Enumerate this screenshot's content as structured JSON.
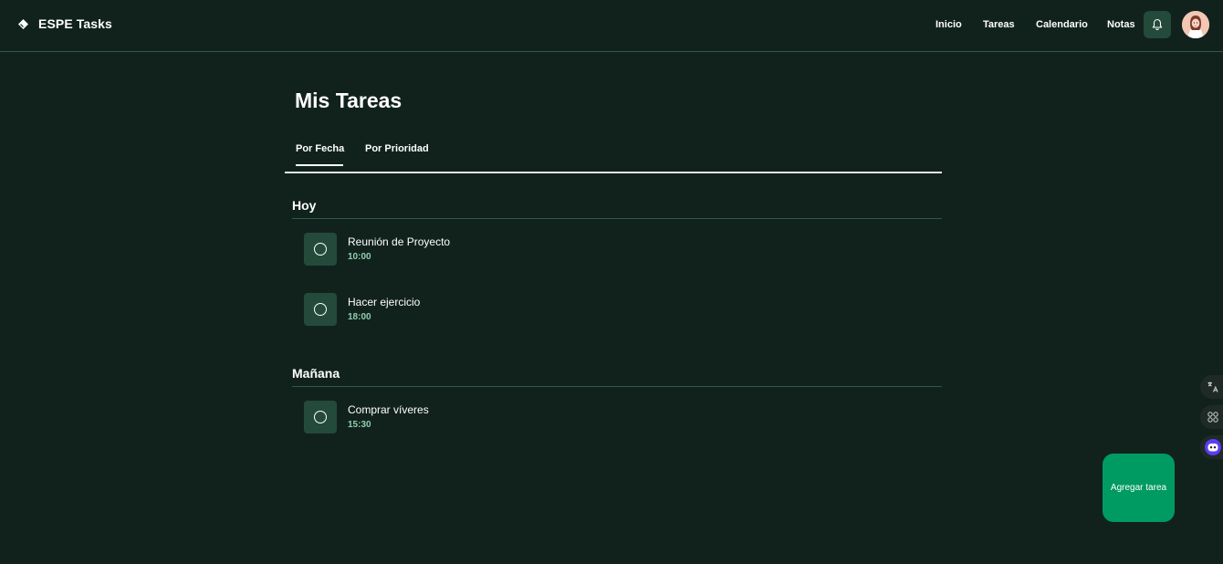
{
  "app": {
    "name": "ESPE Tasks"
  },
  "nav": {
    "inicio": "Inicio",
    "tareas": "Tareas",
    "calendario": "Calendario",
    "notas": "Notas"
  },
  "page": {
    "title": "Mis Tareas"
  },
  "tabs": {
    "by_date": "Por Fecha",
    "by_priority": "Por Prioridad",
    "active": "Por Fecha"
  },
  "groups": [
    {
      "title": "Hoy",
      "tasks": [
        {
          "name": "Reunión de Proyecto",
          "time": "10:00"
        },
        {
          "name": "Hacer ejercicio",
          "time": "18:00"
        }
      ]
    },
    {
      "title": "Mañana",
      "tasks": [
        {
          "name": "Comprar víveres",
          "time": "15:30"
        }
      ]
    }
  ],
  "fab": {
    "label": "Agregar tarea"
  },
  "colors": {
    "background": "#11221d",
    "accent": "#009a63",
    "card": "#244a3c",
    "time": "#8fcfae",
    "divider": "#2c5a46"
  },
  "icons": [
    "brand-icon",
    "bell-icon",
    "avatar",
    "check-circle-icon",
    "translate-icon",
    "command-icon",
    "assistant-icon"
  ]
}
